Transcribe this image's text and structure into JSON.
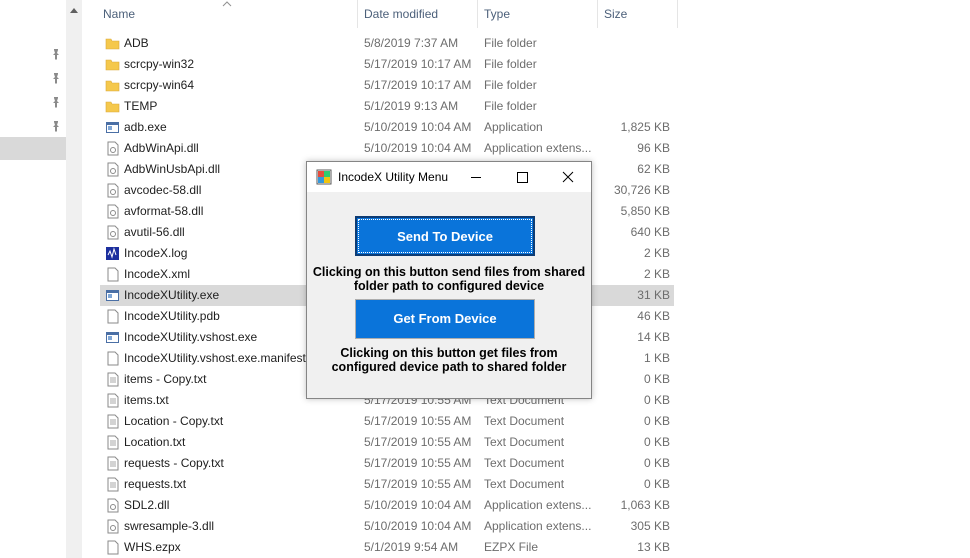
{
  "columns": {
    "name": "Name",
    "date": "Date modified",
    "type": "Type",
    "size": "Size"
  },
  "files": [
    {
      "name": "ADB",
      "date": "5/8/2019 7:37 AM",
      "type": "File folder",
      "size": "",
      "icon": "folder-icon"
    },
    {
      "name": "scrcpy-win32",
      "date": "5/17/2019 10:17 AM",
      "type": "File folder",
      "size": "",
      "icon": "folder-icon"
    },
    {
      "name": "scrcpy-win64",
      "date": "5/17/2019 10:17 AM",
      "type": "File folder",
      "size": "",
      "icon": "folder-icon"
    },
    {
      "name": "TEMP",
      "date": "5/1/2019 9:13 AM",
      "type": "File folder",
      "size": "",
      "icon": "folder-icon"
    },
    {
      "name": "adb.exe",
      "date": "5/10/2019 10:04 AM",
      "type": "Application",
      "size": "1,825 KB",
      "icon": "exe-icon"
    },
    {
      "name": "AdbWinApi.dll",
      "date": "5/10/2019 10:04 AM",
      "type": "Application extens...",
      "size": "96 KB",
      "icon": "dll-icon"
    },
    {
      "name": "AdbWinUsbApi.dll",
      "date": "",
      "type": "",
      "size": "62 KB",
      "icon": "dll-icon"
    },
    {
      "name": "avcodec-58.dll",
      "date": "",
      "type": "",
      "size": "30,726 KB",
      "icon": "dll-icon"
    },
    {
      "name": "avformat-58.dll",
      "date": "",
      "type": "",
      "size": "5,850 KB",
      "icon": "dll-icon"
    },
    {
      "name": "avutil-56.dll",
      "date": "",
      "type": "",
      "size": "640 KB",
      "icon": "dll-icon"
    },
    {
      "name": "IncodeX.log",
      "date": "",
      "type": "",
      "size": "2 KB",
      "icon": "log-icon"
    },
    {
      "name": "IncodeX.xml",
      "date": "",
      "type": "",
      "size": "2 KB",
      "icon": "document-icon"
    },
    {
      "name": "IncodeXUtility.exe",
      "date": "",
      "type": "",
      "size": "31 KB",
      "icon": "exe-icon",
      "selected": true
    },
    {
      "name": "IncodeXUtility.pdb",
      "date": "",
      "type": "",
      "size": "46 KB",
      "icon": "document-icon"
    },
    {
      "name": "IncodeXUtility.vshost.exe",
      "date": "",
      "type": "",
      "size": "14 KB",
      "icon": "exe-icon"
    },
    {
      "name": "IncodeXUtility.vshost.exe.manifest",
      "date": "",
      "type": "",
      "size": "1 KB",
      "icon": "document-icon"
    },
    {
      "name": "items - Copy.txt",
      "date": "",
      "type": "",
      "size": "0 KB",
      "icon": "text-icon"
    },
    {
      "name": "items.txt",
      "date": "5/17/2019 10:55 AM",
      "type": "Text Document",
      "size": "0 KB",
      "icon": "text-icon"
    },
    {
      "name": "Location - Copy.txt",
      "date": "5/17/2019 10:55 AM",
      "type": "Text Document",
      "size": "0 KB",
      "icon": "text-icon"
    },
    {
      "name": "Location.txt",
      "date": "5/17/2019 10:55 AM",
      "type": "Text Document",
      "size": "0 KB",
      "icon": "text-icon"
    },
    {
      "name": "requests - Copy.txt",
      "date": "5/17/2019 10:55 AM",
      "type": "Text Document",
      "size": "0 KB",
      "icon": "text-icon"
    },
    {
      "name": "requests.txt",
      "date": "5/17/2019 10:55 AM",
      "type": "Text Document",
      "size": "0 KB",
      "icon": "text-icon"
    },
    {
      "name": "SDL2.dll",
      "date": "5/10/2019 10:04 AM",
      "type": "Application extens...",
      "size": "1,063 KB",
      "icon": "dll-icon"
    },
    {
      "name": "swresample-3.dll",
      "date": "5/10/2019 10:04 AM",
      "type": "Application extens...",
      "size": "305 KB",
      "icon": "dll-icon"
    },
    {
      "name": "WHS.ezpx",
      "date": "5/1/2019 9:54 AM",
      "type": "EZPX File",
      "size": "13 KB",
      "icon": "document-icon"
    }
  ],
  "dialog": {
    "title": "IncodeX Utility Menu",
    "send_button": "Send To Device",
    "send_description": "Clicking on this button send files from shared folder path to configured device",
    "get_button": "Get From Device",
    "get_description": "Clicking on this button get files from configured device path to shared folder"
  },
  "colors": {
    "accent_button": "#0a74da",
    "selected_row": "#d9d9d9",
    "header_text": "#4c607a",
    "folder": "#f5c84c"
  }
}
